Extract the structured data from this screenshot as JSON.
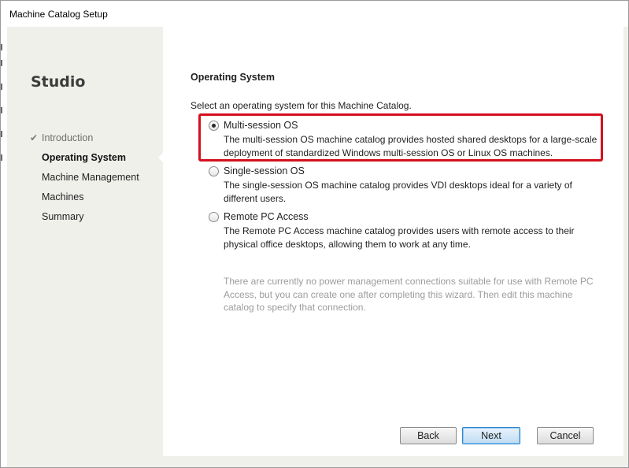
{
  "window": {
    "title": "Machine Catalog Setup"
  },
  "sidebar": {
    "brand": "Studio",
    "steps": [
      {
        "label": "Introduction",
        "state": "done"
      },
      {
        "label": "Operating System",
        "state": "active"
      },
      {
        "label": "Machine Management",
        "state": "pending"
      },
      {
        "label": "Machines",
        "state": "pending"
      },
      {
        "label": "Summary",
        "state": "pending"
      }
    ]
  },
  "main": {
    "section_title": "Operating System",
    "prompt": "Select an operating system for this Machine Catalog.",
    "options": [
      {
        "label": "Multi-session OS",
        "description": "The multi-session OS machine catalog provides hosted shared desktops for a large-scale deployment of standardized Windows multi-session OS or Linux OS machines.",
        "selected": true
      },
      {
        "label": "Single-session OS",
        "description": "The single-session OS machine catalog provides VDI desktops ideal for a variety of different users.",
        "selected": false
      },
      {
        "label": "Remote PC Access",
        "description": "The Remote PC Access machine catalog provides users with remote access to their physical office desktops, allowing them to work at any time.",
        "selected": false
      }
    ],
    "note": "There are currently no power management connections suitable for use with Remote PC Access, but you can create one after completing this wizard. Then edit this machine catalog to specify that connection."
  },
  "buttons": {
    "back": "Back",
    "next": "Next",
    "cancel": "Cancel"
  },
  "colors": {
    "sidebar_bg": "#eff0ea",
    "highlight_border": "#d4101e",
    "primary_button_border": "#2e86cf",
    "note_text": "#9c9c9c"
  },
  "icons": {
    "completed_step": "checkmark-icon",
    "radio_selected": "radio-checked-icon",
    "radio_unselected": "radio-unchecked-icon"
  }
}
